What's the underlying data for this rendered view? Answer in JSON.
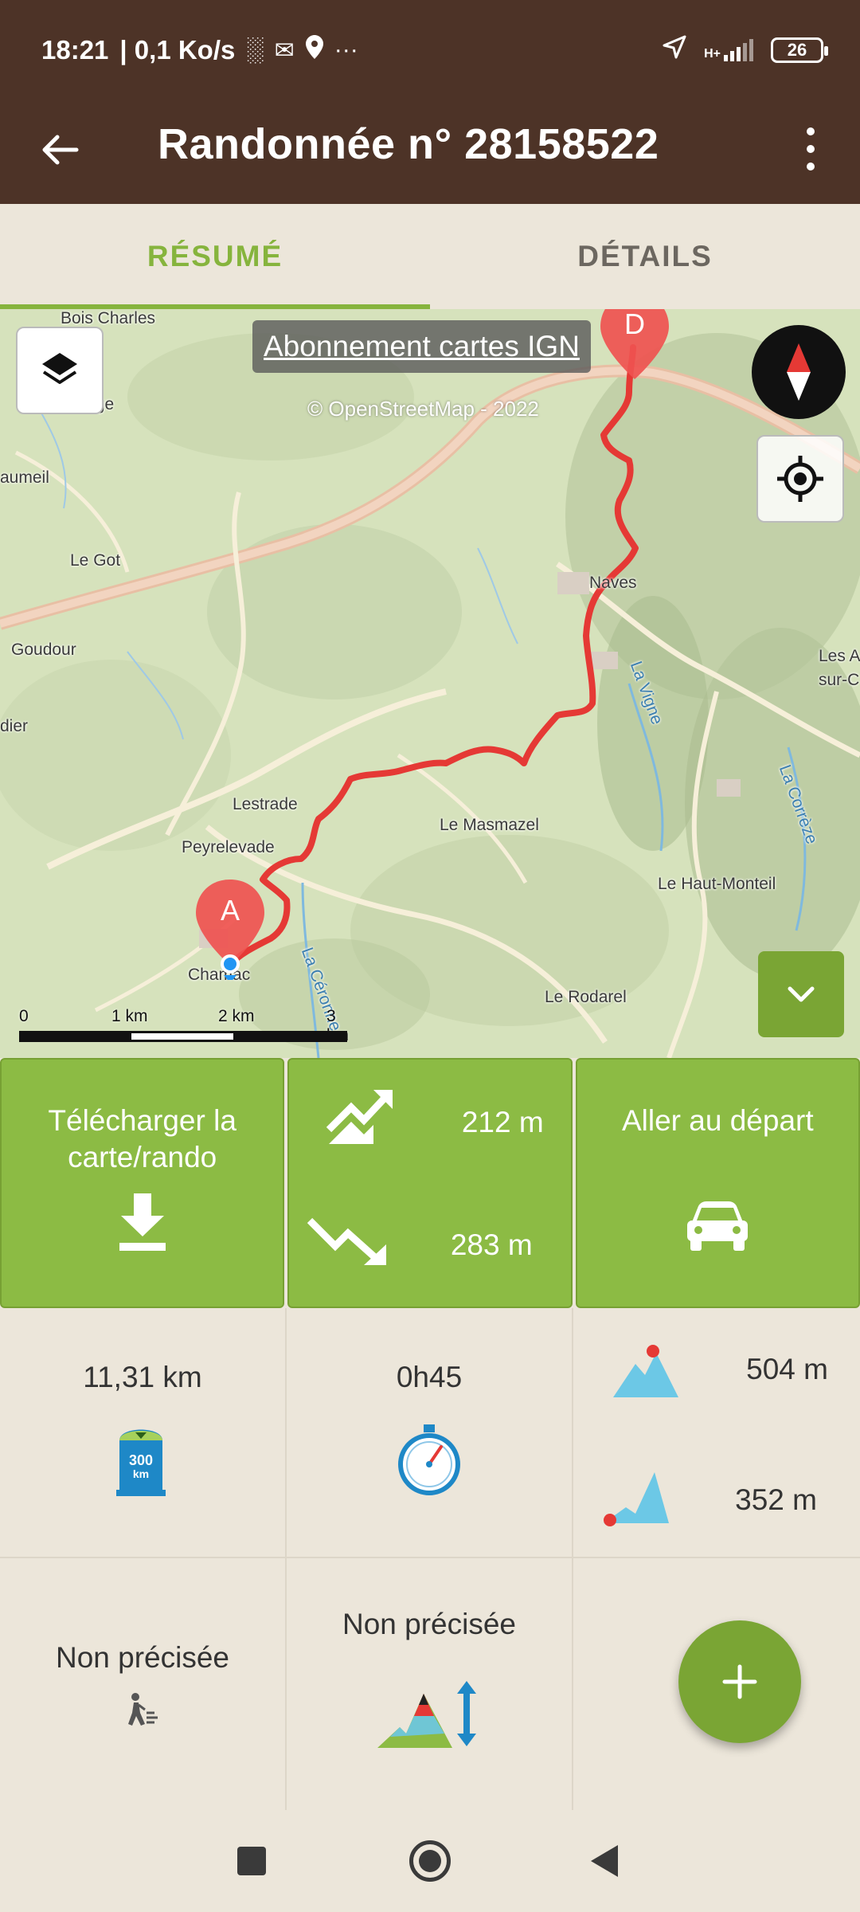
{
  "status_bar": {
    "time": "18:21",
    "speed": "| 0,1 Ko/s",
    "network": "H+",
    "battery": "26",
    "more": "···",
    "icons": [
      "sim-icon",
      "mail-icon",
      "location-pin-icon",
      "navigation-icon",
      "signal-icon",
      "battery-icon"
    ]
  },
  "app_bar": {
    "title": "Randonnée n° 28158522",
    "back_icon": "arrow-left-icon",
    "menu_icon": "more-vert-icon"
  },
  "tabs": [
    {
      "label": "RÉSUMÉ",
      "active": true
    },
    {
      "label": "DÉTAILS",
      "active": false
    }
  ],
  "map": {
    "ign_banner": "Abonnement cartes IGN",
    "attribution": "© OpenStreetMap - 2022",
    "start_marker": "A",
    "end_marker": "D",
    "places": [
      "Bois Charles",
      "Lafarge",
      "aumeil",
      "Le Got",
      "Goudour",
      "dier",
      "Lestrade",
      "Peyrelevade",
      "Chamac",
      "Le Masmazel",
      "Naves",
      "La Vigne",
      "Les A",
      "sur-C",
      "La Corrèze",
      "Le Haut-Monteil",
      "Le Rodarel",
      "La Céronne"
    ],
    "scale": {
      "labels": [
        "0",
        "1 km",
        "2 km",
        "3 km"
      ]
    },
    "route_color": "#e53935"
  },
  "actions": {
    "download_label": "Télécharger la carte/rando",
    "ascent": "212 m",
    "descent": "283 m",
    "go_start_label": "Aller au départ"
  },
  "stats": {
    "distance": "11,31 km",
    "duration": "0h45",
    "alt_max": "504 m",
    "alt_min": "352 m",
    "difficulty": "Non précisée",
    "elevation_class": "Non précisée"
  },
  "colors": {
    "brown": "#4d3327",
    "green": "#8cbb44",
    "accent": "#86b43d"
  }
}
